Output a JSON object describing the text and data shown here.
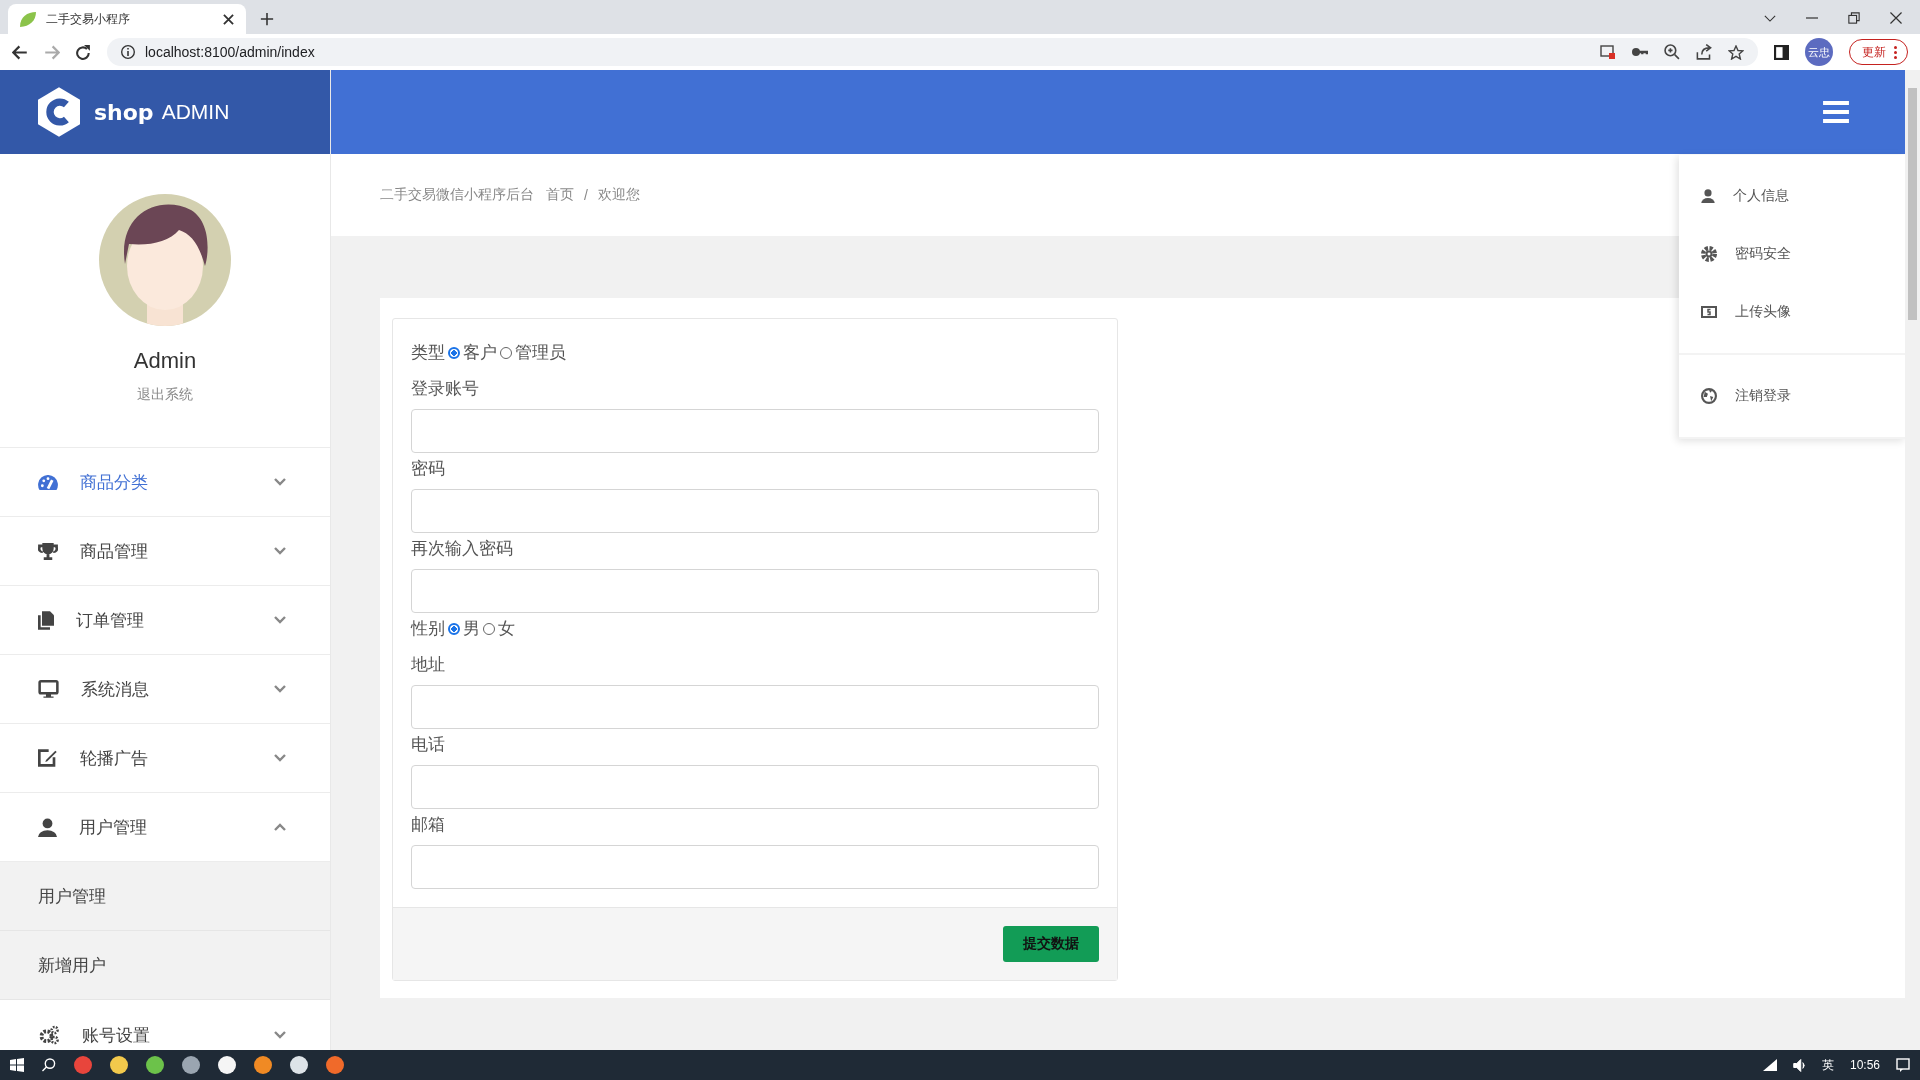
{
  "browser": {
    "tab_title": "二手交易小程序",
    "address": "localhost:8100/admin/index",
    "profile": "云忠",
    "update_button": "更新"
  },
  "header": {
    "logo_bold": "shop",
    "logo_light": "ADMIN"
  },
  "sidebar": {
    "user_name": "Admin",
    "logout": "退出系统",
    "items": [
      {
        "label": "商品分类",
        "selected": true,
        "expanded": false
      },
      {
        "label": "商品管理",
        "selected": false,
        "expanded": false
      },
      {
        "label": "订单管理",
        "selected": false,
        "expanded": false
      },
      {
        "label": "系统消息",
        "selected": false,
        "expanded": false
      },
      {
        "label": "轮播广告",
        "selected": false,
        "expanded": false
      },
      {
        "label": "用户管理",
        "selected": false,
        "expanded": true,
        "children": [
          {
            "label": "用户管理"
          },
          {
            "label": "新增用户"
          }
        ]
      },
      {
        "label": "账号设置",
        "selected": false,
        "expanded": false
      }
    ]
  },
  "breadcrumb": {
    "site": "二手交易微信小程序后台",
    "items": [
      "首页",
      "欢迎您"
    ],
    "separator": "/"
  },
  "form": {
    "fields": [
      {
        "kind": "radio",
        "label": "类型",
        "options": [
          {
            "label": "客户",
            "selected": true
          },
          {
            "label": "管理员",
            "selected": false
          }
        ]
      },
      {
        "kind": "text",
        "label": "登录账号"
      },
      {
        "kind": "text",
        "label": "密码"
      },
      {
        "kind": "text",
        "label": "再次输入密码"
      },
      {
        "kind": "radio",
        "label": "性别",
        "options": [
          {
            "label": "男",
            "selected": true
          },
          {
            "label": "女",
            "selected": false
          }
        ]
      },
      {
        "kind": "text",
        "label": "地址"
      },
      {
        "kind": "text",
        "label": "电话"
      },
      {
        "kind": "text",
        "label": "邮箱"
      }
    ],
    "submit": "提交数据"
  },
  "user_menu": {
    "items": [
      {
        "label": "个人信息"
      },
      {
        "label": "密码安全"
      },
      {
        "label": "上传头像"
      }
    ],
    "footer_items": [
      {
        "label": "注销登录"
      }
    ]
  },
  "taskbar": {
    "ime": "英",
    "time": "10:56"
  }
}
